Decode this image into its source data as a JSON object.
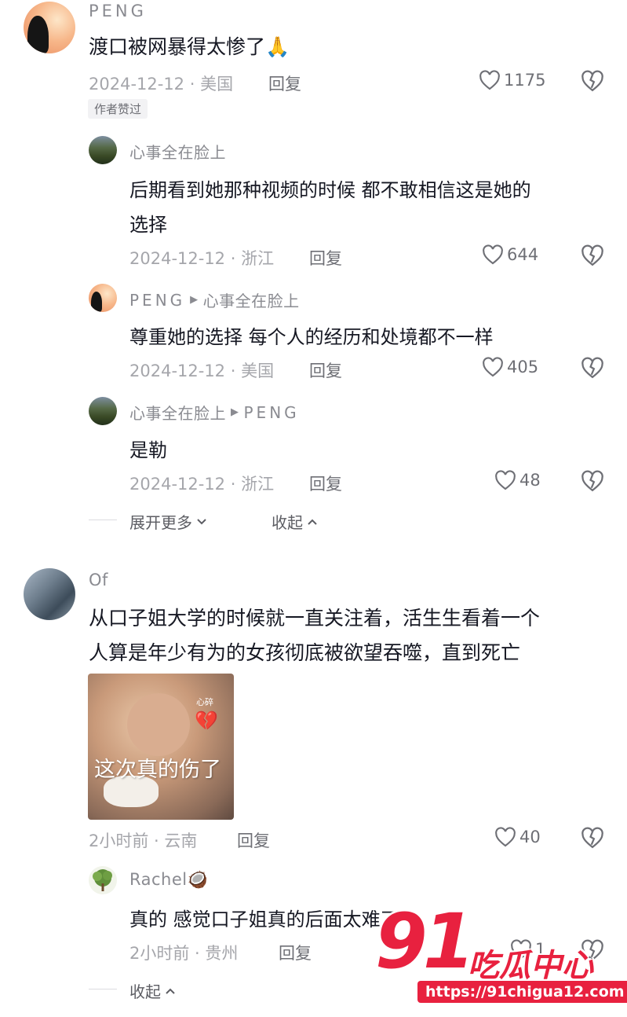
{
  "comments": [
    {
      "user": "PENG",
      "text": "渡口被网暴得太惨了🙏",
      "date_loc": "2024-12-12 · 美国",
      "reply_label": "回复",
      "likes": "1175",
      "badge": "作者赞过",
      "replies": [
        {
          "user": "心事全在脸上",
          "text_line1": "后期看到她那种视频的时候 都不敢相信这是她的",
          "text_line2": "选择",
          "date_loc": "2024-12-12 · 浙江",
          "reply_label": "回复",
          "likes": "644"
        },
        {
          "user": "PENG",
          "arrow": "▶",
          "target": "心事全在脸上",
          "text": "尊重她的选择 每个人的经历和处境都不一样",
          "date_loc": "2024-12-12 · 美国",
          "reply_label": "回复",
          "likes": "405"
        },
        {
          "user": "心事全在脸上",
          "arrow": "▶",
          "target": "PENG",
          "text": "是勒",
          "date_loc": "2024-12-12 · 浙江",
          "reply_label": "回复",
          "likes": "48"
        }
      ],
      "expand_label": "展开更多",
      "collapse_label": "收起"
    },
    {
      "user": "Of",
      "text_line1": "从口子姐大学的时候就一直关注着，活生生看着一个",
      "text_line2": "人算是年少有为的女孩彻底被欲望吞噬，直到死亡",
      "meme_small": "心碎",
      "meme_caption": "这次真的伤了",
      "date_loc": "2小时前 · 云南",
      "reply_label": "回复",
      "likes": "40",
      "replies": [
        {
          "user": "Rachel🥥",
          "text": "真的 感觉口子姐真的后面太难了",
          "date_loc": "2小时前 · 贵州",
          "reply_label": "回复",
          "likes": "1"
        }
      ],
      "collapse_label": "收起"
    }
  ],
  "watermark": {
    "number": "91",
    "brand": "吃瓜中心",
    "url": "https://91chigua12.com"
  },
  "icons": {
    "like": "heart-outline-icon",
    "dislike": "broken-heart-icon",
    "chevron_down": "chevron-down-icon",
    "chevron_up": "chevron-up-icon"
  }
}
